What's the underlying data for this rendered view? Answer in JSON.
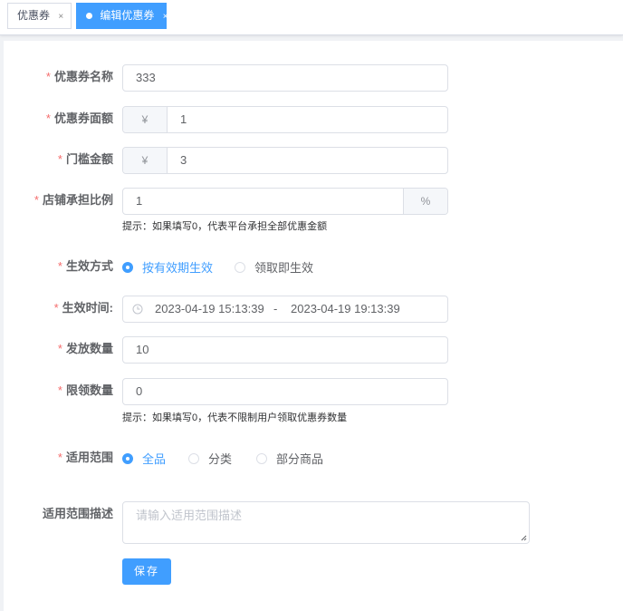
{
  "tabs": [
    {
      "label": "优惠券",
      "close": "×"
    },
    {
      "label": "编辑优惠券",
      "close": "×"
    }
  ],
  "form": {
    "required_mark": "*",
    "name": {
      "label": "优惠券名称",
      "value": "333"
    },
    "face_value": {
      "label": "优惠券面额",
      "prefix": "¥",
      "value": "1"
    },
    "threshold": {
      "label": "门槛金额",
      "prefix": "¥",
      "value": "3"
    },
    "store_ratio": {
      "label": "店铺承担比例",
      "value": "1",
      "suffix": "%",
      "hint": "提示：如果填写0，代表平台承担全部优惠金额"
    },
    "effect_mode": {
      "label": "生效方式",
      "options": [
        "按有效期生效",
        "领取即生效"
      ],
      "selected": "按有效期生效"
    },
    "effect_time": {
      "label": "生效时间:",
      "start": "2023-04-19 15:13:39",
      "separator": "-",
      "end": "2023-04-19 19:13:39"
    },
    "issue_qty": {
      "label": "发放数量",
      "value": "10"
    },
    "limit_qty": {
      "label": "限领数量",
      "value": "0",
      "hint": "提示：如果填写0，代表不限制用户领取优惠券数量"
    },
    "scope": {
      "label": "适用范围",
      "options": [
        "全品",
        "分类",
        "部分商品"
      ],
      "selected": "全品"
    },
    "scope_desc": {
      "label": "适用范围描述",
      "placeholder": "请输入适用范围描述"
    },
    "save_label": "保存"
  },
  "colors": {
    "accent": "#409eff",
    "required": "#f56c6c"
  },
  "icons": {
    "clock": "clock-icon",
    "radio": "radio-icon"
  }
}
